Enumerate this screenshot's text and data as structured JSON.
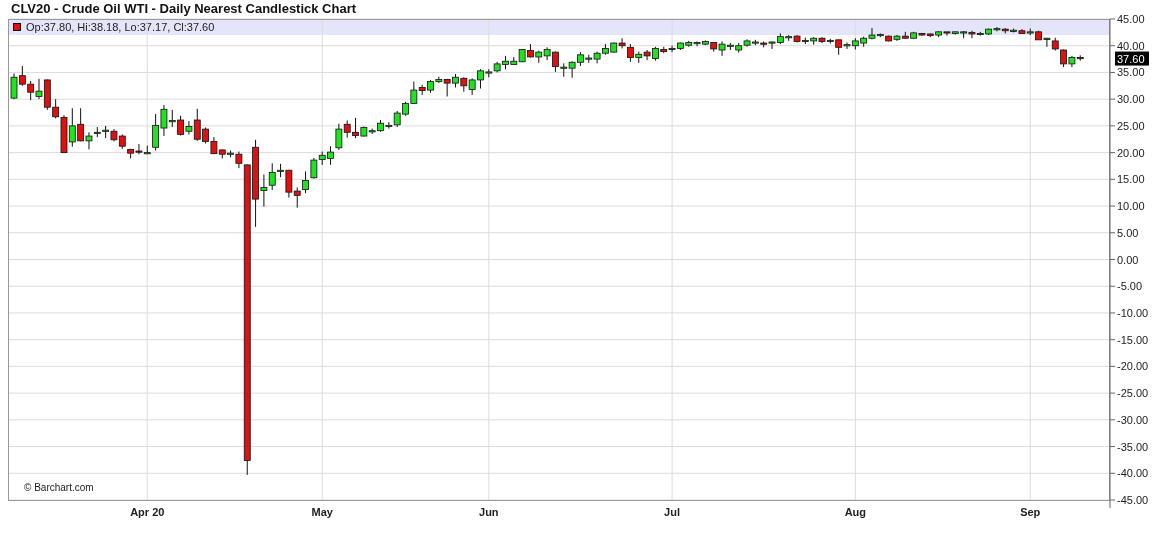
{
  "title": "CLV20 - Crude Oil WTI - Daily Nearest Candlestick Chart",
  "legend": "Op:37.80, Hi:38.18, Lo:37.17, Cl:37.60",
  "last_price_label": "37.60",
  "credit": "© Barchart.com",
  "chart_data": {
    "type": "candlestick",
    "ylim": [
      -45,
      45
    ],
    "grid": true,
    "yticks": [
      {
        "value": 45,
        "label": "45.00"
      },
      {
        "value": 40,
        "label": "40.00"
      },
      {
        "value": 35,
        "label": "35.00"
      },
      {
        "value": 30,
        "label": "30.00"
      },
      {
        "value": 25,
        "label": "25.00"
      },
      {
        "value": 20,
        "label": "20.00"
      },
      {
        "value": 15,
        "label": "15.00"
      },
      {
        "value": 10,
        "label": "10.00"
      },
      {
        "value": 5,
        "label": "5.00"
      },
      {
        "value": 0,
        "label": "0.00"
      },
      {
        "value": -5,
        "label": "-5.00"
      },
      {
        "value": -10,
        "label": "-10.00"
      },
      {
        "value": -15,
        "label": "-15.00"
      },
      {
        "value": -20,
        "label": "-20.00"
      },
      {
        "value": -25,
        "label": "-25.00"
      },
      {
        "value": -30,
        "label": "-30.00"
      },
      {
        "value": -35,
        "label": "-35.00"
      },
      {
        "value": -40,
        "label": "-40.00"
      },
      {
        "value": -45,
        "label": "-45.00"
      }
    ],
    "categories": [
      null,
      null,
      null,
      null,
      null,
      null,
      null,
      null,
      null,
      null,
      null,
      null,
      null,
      null,
      null,
      null,
      "Apr 20",
      null,
      null,
      null,
      null,
      null,
      null,
      null,
      null,
      null,
      null,
      null,
      null,
      null,
      null,
      null,
      null,
      null,
      null,
      null,
      null,
      "May",
      null,
      null,
      null,
      null,
      null,
      null,
      null,
      null,
      null,
      null,
      null,
      null,
      null,
      null,
      null,
      null,
      null,
      null,
      null,
      "Jun",
      null,
      null,
      null,
      null,
      null,
      null,
      null,
      null,
      null,
      null,
      null,
      null,
      null,
      null,
      null,
      null,
      null,
      null,
      null,
      null,
      null,
      "Jul",
      null,
      null,
      null,
      null,
      null,
      null,
      null,
      null,
      null,
      null,
      null,
      null,
      null,
      null,
      null,
      null,
      null,
      null,
      null,
      null,
      null,
      "Aug",
      null,
      null,
      null,
      null,
      null,
      null,
      null,
      null,
      null,
      null,
      null,
      null,
      null,
      null,
      null,
      null,
      null,
      null,
      null,
      null,
      "Sep",
      null,
      null,
      null,
      null,
      null,
      null
    ],
    "ohlc": [
      [
        30.2,
        34.8,
        30.0,
        34.1
      ],
      [
        34.4,
        36.2,
        32.5,
        32.8
      ],
      [
        32.8,
        33.4,
        29.8,
        31.3
      ],
      [
        30.5,
        33.8,
        30.0,
        31.5
      ],
      [
        33.6,
        33.7,
        28.0,
        28.5
      ],
      [
        28.5,
        30.0,
        26.4,
        26.7
      ],
      [
        26.6,
        27.0,
        19.9,
        20.0
      ],
      [
        22.0,
        28.3,
        21.1,
        25.0
      ],
      [
        25.3,
        28.3,
        22.1,
        22.2
      ],
      [
        22.2,
        23.8,
        20.6,
        23.1
      ],
      [
        23.7,
        24.8,
        22.9,
        23.8
      ],
      [
        24.2,
        25.0,
        22.7,
        24.2
      ],
      [
        24.0,
        24.4,
        22.1,
        22.4
      ],
      [
        23.1,
        23.4,
        20.7,
        21.2
      ],
      [
        20.6,
        20.7,
        18.9,
        19.9
      ],
      [
        20.3,
        21.6,
        19.7,
        20.2
      ],
      [
        19.9,
        21.3,
        19.7,
        20.0
      ],
      [
        21.0,
        27.2,
        20.4,
        25.1
      ],
      [
        24.6,
        28.9,
        23.1,
        28.1
      ],
      [
        25.9,
        28.0,
        24.8,
        26.0
      ],
      [
        26.1,
        26.9,
        23.2,
        23.4
      ],
      [
        24.0,
        25.9,
        23.4,
        24.9
      ],
      [
        26.1,
        28.2,
        22.2,
        22.5
      ],
      [
        24.4,
        24.7,
        21.7,
        22.1
      ],
      [
        22.1,
        22.9,
        19.7,
        19.8
      ],
      [
        20.5,
        20.6,
        18.9,
        19.7
      ],
      [
        19.8,
        20.4,
        19.1,
        19.9
      ],
      [
        19.7,
        20.2,
        17.1,
        18.0
      ],
      [
        17.7,
        17.8,
        -40.3,
        -37.6
      ],
      [
        21.0,
        22.4,
        6.1,
        11.3
      ],
      [
        12.9,
        15.9,
        9.9,
        13.5
      ],
      [
        13.9,
        18.0,
        13.0,
        16.3
      ],
      [
        16.6,
        17.9,
        15.4,
        16.7
      ],
      [
        16.7,
        16.8,
        11.6,
        12.6
      ],
      [
        12.8,
        13.5,
        9.7,
        12.0
      ],
      [
        13.1,
        16.5,
        12.4,
        14.8
      ],
      [
        15.3,
        19.0,
        15.1,
        18.6
      ],
      [
        18.7,
        20.2,
        17.7,
        19.5
      ],
      [
        18.9,
        21.2,
        17.7,
        20.1
      ],
      [
        20.9,
        25.4,
        20.5,
        24.4
      ],
      [
        25.3,
        26.0,
        22.8,
        23.8
      ],
      [
        23.8,
        26.5,
        22.7,
        23.2
      ],
      [
        23.1,
        24.9,
        23.0,
        24.7
      ],
      [
        24.0,
        24.5,
        23.5,
        24.1
      ],
      [
        24.1,
        26.1,
        23.9,
        25.5
      ],
      [
        25.0,
        25.7,
        24.5,
        25.1
      ],
      [
        25.2,
        27.8,
        24.8,
        27.4
      ],
      [
        27.2,
        29.5,
        26.9,
        29.2
      ],
      [
        29.2,
        33.3,
        29.1,
        31.7
      ],
      [
        32.2,
        32.7,
        30.8,
        31.6
      ],
      [
        31.7,
        33.6,
        31.2,
        33.3
      ],
      [
        33.3,
        34.2,
        33.0,
        33.7
      ],
      [
        33.7,
        33.8,
        30.5,
        33.0
      ],
      [
        33.0,
        34.7,
        32.2,
        34.1
      ],
      [
        33.9,
        34.1,
        31.4,
        32.5
      ],
      [
        31.8,
        33.9,
        30.8,
        33.6
      ],
      [
        33.6,
        35.6,
        32.0,
        35.3
      ],
      [
        35.0,
        35.6,
        34.1,
        35.1
      ],
      [
        35.3,
        37.0,
        35.0,
        36.6
      ],
      [
        36.5,
        38.1,
        35.6,
        37.1
      ],
      [
        36.5,
        37.9,
        36.4,
        37.1
      ],
      [
        37.0,
        39.4,
        36.9,
        39.3
      ],
      [
        39.1,
        40.3,
        37.8,
        37.9
      ],
      [
        37.9,
        39.1,
        36.8,
        38.8
      ],
      [
        38.1,
        39.7,
        37.3,
        39.3
      ],
      [
        38.8,
        38.9,
        35.1,
        36.1
      ],
      [
        35.9,
        36.7,
        34.2,
        36.0
      ],
      [
        35.8,
        37.1,
        34.0,
        36.9
      ],
      [
        36.9,
        38.8,
        36.2,
        38.3
      ],
      [
        37.6,
        38.3,
        36.8,
        37.7
      ],
      [
        37.5,
        38.9,
        36.7,
        38.6
      ],
      [
        38.6,
        40.3,
        38.3,
        39.5
      ],
      [
        38.8,
        40.6,
        38.7,
        40.5
      ],
      [
        40.5,
        41.4,
        39.5,
        40.0
      ],
      [
        39.7,
        40.3,
        37.0,
        37.8
      ],
      [
        37.8,
        38.9,
        36.8,
        38.4
      ],
      [
        38.8,
        39.2,
        37.3,
        38.1
      ],
      [
        37.6,
        39.8,
        37.2,
        39.5
      ],
      [
        39.3,
        39.8,
        38.6,
        38.9
      ],
      [
        39.4,
        40.0,
        38.8,
        39.5
      ],
      [
        39.5,
        40.6,
        39.2,
        40.5
      ],
      [
        40.1,
        40.9,
        39.8,
        40.6
      ],
      [
        40.5,
        40.8,
        39.9,
        40.6
      ],
      [
        40.3,
        41.0,
        40.1,
        40.8
      ],
      [
        40.6,
        40.7,
        38.9,
        39.4
      ],
      [
        39.2,
        40.8,
        38.1,
        40.3
      ],
      [
        40.0,
        40.5,
        39.2,
        40.1
      ],
      [
        39.2,
        40.5,
        38.7,
        40.0
      ],
      [
        40.1,
        41.2,
        39.8,
        40.9
      ],
      [
        40.6,
        41.1,
        40.1,
        40.7
      ],
      [
        40.5,
        40.8,
        39.7,
        40.4
      ],
      [
        40.6,
        40.8,
        39.4,
        40.7
      ],
      [
        40.6,
        42.3,
        40.3,
        41.7
      ],
      [
        41.6,
        42.0,
        40.9,
        41.7
      ],
      [
        41.8,
        42.0,
        40.6,
        40.8
      ],
      [
        40.9,
        41.5,
        40.3,
        41.0
      ],
      [
        40.9,
        41.6,
        40.2,
        41.4
      ],
      [
        41.4,
        41.6,
        40.5,
        40.8
      ],
      [
        40.9,
        41.3,
        40.4,
        41.0
      ],
      [
        41.1,
        41.2,
        38.3,
        39.7
      ],
      [
        40.1,
        40.6,
        39.4,
        40.2
      ],
      [
        40.0,
        41.4,
        39.3,
        40.9
      ],
      [
        40.5,
        41.7,
        39.8,
        41.4
      ],
      [
        41.4,
        43.3,
        41.2,
        42.0
      ],
      [
        42.0,
        42.3,
        41.6,
        42.1
      ],
      [
        41.8,
        41.9,
        40.8,
        40.9
      ],
      [
        41.2,
        42.0,
        40.9,
        41.8
      ],
      [
        41.8,
        42.6,
        41.3,
        41.4
      ],
      [
        41.4,
        42.6,
        41.3,
        42.4
      ],
      [
        42.3,
        42.4,
        41.8,
        42.0
      ],
      [
        42.2,
        42.3,
        41.6,
        41.9
      ],
      [
        42.0,
        42.7,
        41.6,
        42.6
      ],
      [
        42.6,
        42.6,
        41.9,
        42.5
      ],
      [
        42.3,
        42.7,
        42.1,
        42.6
      ],
      [
        42.6,
        42.7,
        41.4,
        42.6
      ],
      [
        42.5,
        42.8,
        41.4,
        42.2
      ],
      [
        42.2,
        42.6,
        41.9,
        42.3
      ],
      [
        42.2,
        43.2,
        42.0,
        43.1
      ],
      [
        43.1,
        43.5,
        42.7,
        43.2
      ],
      [
        43.1,
        43.3,
        42.3,
        42.8
      ],
      [
        42.8,
        43.2,
        42.5,
        42.9
      ],
      [
        42.8,
        43.1,
        42.2,
        42.3
      ],
      [
        42.5,
        43.2,
        42.0,
        42.6
      ],
      [
        42.6,
        42.8,
        41.1,
        41.1
      ],
      [
        41.3,
        41.5,
        39.8,
        41.4
      ],
      [
        40.9,
        41.5,
        39.1,
        39.4
      ],
      [
        39.2,
        39.3,
        36.0,
        36.6
      ],
      [
        36.6,
        38.1,
        36.0,
        37.8
      ],
      [
        37.8,
        38.2,
        37.2,
        37.6
      ]
    ]
  }
}
